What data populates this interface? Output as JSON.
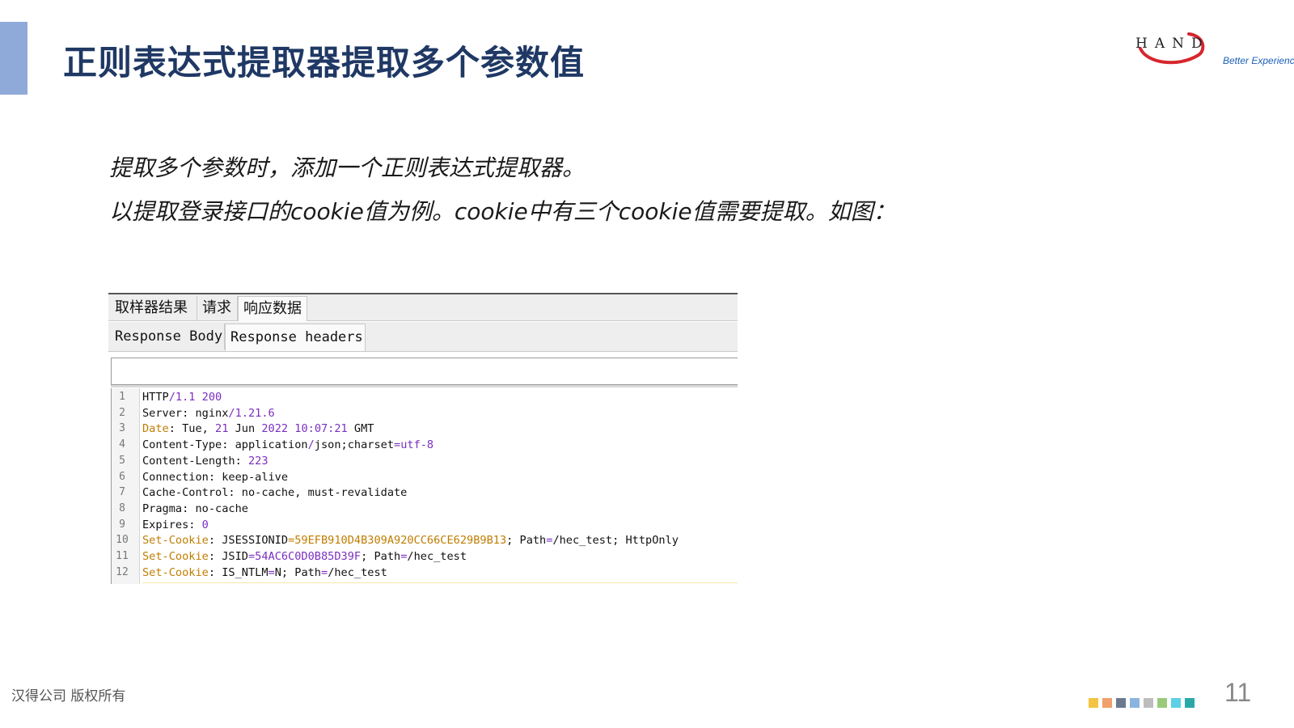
{
  "slide": {
    "title": "正则表达式提取器提取多个参数值",
    "line1": "提取多个参数时，添加一个正则表达式提取器。",
    "line2": "以提取登录接口的cookie值为例。cookie中有三个cookie值需要提取。如图："
  },
  "logo": {
    "brand": "HAND",
    "tagline": "Better Experience"
  },
  "viewer": {
    "tabs": [
      "取样器结果",
      "请求",
      "响应数据"
    ],
    "active_tab": "响应数据",
    "subtabs": [
      "Response Body",
      "Response headers"
    ],
    "active_subtab": "Response headers",
    "search_value": "",
    "lines": [
      {
        "num": "1",
        "segments": [
          {
            "t": "HTTP",
            "c": "k"
          },
          {
            "t": "/1.1 200",
            "c": "v"
          }
        ]
      },
      {
        "num": "2",
        "segments": [
          {
            "t": "Server: nginx",
            "c": "k"
          },
          {
            "t": "/1.21.6",
            "c": "v"
          }
        ]
      },
      {
        "num": "3",
        "segments": [
          {
            "t": "Date",
            "c": "kh"
          },
          {
            "t": ": Tue, ",
            "c": "k"
          },
          {
            "t": "21",
            "c": "v"
          },
          {
            "t": " Jun ",
            "c": "k"
          },
          {
            "t": "2022 10:07:21",
            "c": "v"
          },
          {
            "t": " GMT",
            "c": "k"
          }
        ]
      },
      {
        "num": "4",
        "segments": [
          {
            "t": "Content-Type: application",
            "c": "k"
          },
          {
            "t": "/",
            "c": "v"
          },
          {
            "t": "json;charset",
            "c": "k"
          },
          {
            "t": "=utf-8",
            "c": "v"
          }
        ]
      },
      {
        "num": "5",
        "segments": [
          {
            "t": "Content-Length: ",
            "c": "k"
          },
          {
            "t": "223",
            "c": "v"
          }
        ]
      },
      {
        "num": "6",
        "segments": [
          {
            "t": "Connection: keep-alive",
            "c": "k"
          }
        ]
      },
      {
        "num": "7",
        "segments": [
          {
            "t": "Cache-Control: no-cache, must-revalidate",
            "c": "k"
          }
        ]
      },
      {
        "num": "8",
        "segments": [
          {
            "t": "Pragma: no-cache",
            "c": "k"
          }
        ]
      },
      {
        "num": "9",
        "segments": [
          {
            "t": "Expires: ",
            "c": "k"
          },
          {
            "t": "0",
            "c": "v"
          }
        ]
      },
      {
        "num": "10",
        "segments": [
          {
            "t": "Set-Cookie",
            "c": "kh"
          },
          {
            "t": ": JSESSIONID",
            "c": "k"
          },
          {
            "t": "=59EFB910D4B309A920CC66CE629B9B13",
            "c": "kh"
          },
          {
            "t": "; Path",
            "c": "k"
          },
          {
            "t": "=",
            "c": "v"
          },
          {
            "t": "/hec_test; HttpOnly",
            "c": "k"
          }
        ]
      },
      {
        "num": "11",
        "segments": [
          {
            "t": "Set-Cookie",
            "c": "kh"
          },
          {
            "t": ": JSID",
            "c": "k"
          },
          {
            "t": "=54AC6C0D0B85D39F",
            "c": "v"
          },
          {
            "t": "; Path",
            "c": "k"
          },
          {
            "t": "=",
            "c": "v"
          },
          {
            "t": "/hec_test",
            "c": "k"
          }
        ]
      },
      {
        "num": "12",
        "segments": [
          {
            "t": "Set-Cookie",
            "c": "kh"
          },
          {
            "t": ": IS_NTLM",
            "c": "k"
          },
          {
            "t": "=",
            "c": "v"
          },
          {
            "t": "N; Path",
            "c": "k"
          },
          {
            "t": "=",
            "c": "v"
          },
          {
            "t": "/hec_test",
            "c": "k"
          }
        ]
      }
    ]
  },
  "footer": {
    "copyright": "汉得公司 版权所有",
    "page_number": "11",
    "dot_colors": [
      "#f4c542",
      "#f0a06a",
      "#6b7a8f",
      "#8cb4e0",
      "#bdbdbd",
      "#9bc97a",
      "#5bd0e6",
      "#2aa8a8"
    ]
  },
  "colors": {
    "title": "#1f3864",
    "accent_bar": "#8fa9d9",
    "syntax_header": "#c07d00",
    "syntax_value": "#7b2fbf"
  }
}
